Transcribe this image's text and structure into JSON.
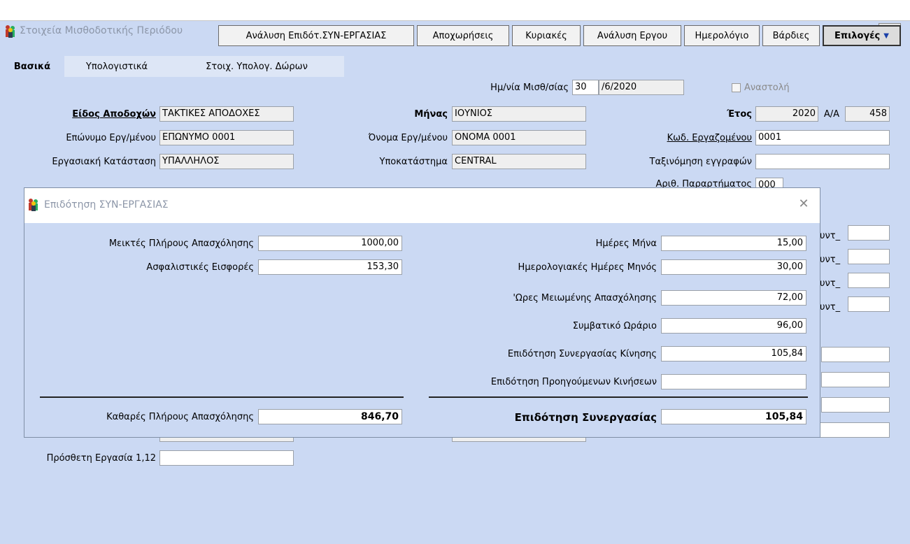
{
  "window": {
    "title": "Στοιχεία Μισθοδοτικής Περιόδου",
    "close_glyph": "⊠"
  },
  "toolbar": {
    "buttons": [
      "Ανάλυση Επιδότ.ΣΥΝ-ΕΡΓΑΣΙΑΣ",
      "Αποχωρήσεις",
      "Κυριακές",
      "Ανάλυση Εργου",
      "Ημερολόγιο",
      "Βάρδιες"
    ],
    "options_label": "Επιλογές",
    "options_arrow": "▼"
  },
  "tabs": [
    "Βασικά",
    "Υπολογιστικά",
    "Στοιχ. Υπολογ. Δώρων"
  ],
  "payroll_date": {
    "label": "Ημ/νία Μισθ/σίας",
    "day": "30",
    "rest": "/6/2020"
  },
  "suspension": {
    "label": "Αναστολή",
    "checked": false
  },
  "form": {
    "earnings_type_label": "Είδος Αποδοχών",
    "earnings_type_value": "ΤΑΚΤΙΚΕΣ ΑΠΟΔΟΧΕΣ",
    "month_label": "Μήνας",
    "month_value": "ΙΟΥΝΙΟΣ",
    "year_label": "Έτος",
    "year_value": "2020",
    "aa_label": "Α/Α",
    "aa_value": "458",
    "surname_label": "Επώνυμο Εργ/μένου",
    "surname_value": "ΕΠΩΝΥΜΟ 0001",
    "firstname_label": "Όνομα Εργ/μένου",
    "firstname_value": "ΟΝΟΜΑ 0001",
    "emp_code_label": "Κωδ. Εργαζομένου",
    "emp_code_value": "0001",
    "status_label": "Εργασιακή Κατάσταση",
    "status_value": "ΥΠΑΛΛΗΛΟΣ",
    "branch_label": "Υποκατάστημα",
    "branch_value": "CENTRAL",
    "classification_label": "Ταξινόμηση εγγραφών",
    "classification_value": "",
    "branch_no_label": "Αριθ. Παραρτήματος",
    "branch_no_value": "000",
    "synt_label": "υντ_",
    "extra_work_label": "Πρόσθετη Εργασία 1,12",
    "extra_work_value": ""
  },
  "dialog": {
    "title": "Επιδότηση ΣΥΝ-ΕΡΓΑΣΙΑΣ",
    "close_glyph": "✕",
    "left_fields": [
      {
        "label": "Μεικτές Πλήρους Απασχόλησης",
        "value": "1000,00"
      },
      {
        "label": "Ασφαλιστικές Εισφορές",
        "value": "153,30"
      }
    ],
    "right_fields": [
      {
        "label": "Ημέρες Μήνα",
        "value": "15,00"
      },
      {
        "label": "Ημερολογιακές Ημέρες Μηνός",
        "value": "30,00"
      },
      {
        "label": "'Ωρες Μειωμένης Απασχόλησης",
        "value": "72,00"
      },
      {
        "label": "Συμβατικό Ωράριο",
        "value": "96,00"
      },
      {
        "label": "Επιδότηση Συνεργασίας Κίνησης",
        "value": "105,84"
      },
      {
        "label": "Επιδότηση Προηγούμενων Κινήσεων",
        "value": ""
      }
    ],
    "net_label": "Καθαρές Πλήρους Απασχόλησης",
    "net_value": "846,70",
    "total_label": "Επιδότηση Συνεργασίας",
    "total_value": "105,84"
  }
}
